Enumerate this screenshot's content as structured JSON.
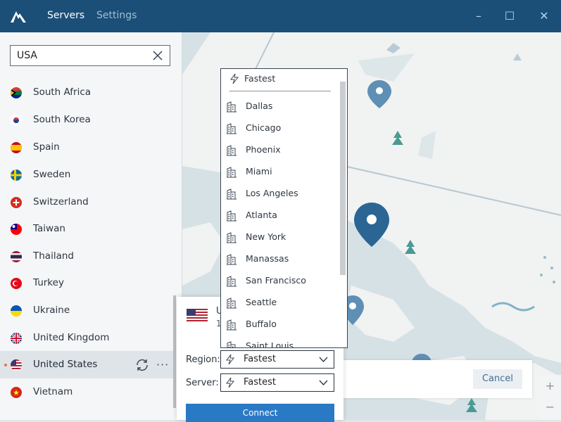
{
  "header": {
    "tabs": [
      "Servers",
      "Settings"
    ],
    "window_controls": [
      "minimize-icon",
      "maximize-icon",
      "close-icon"
    ]
  },
  "search": {
    "value": "USA"
  },
  "countries": [
    {
      "name": "South Africa",
      "flag": "south-africa-flag-icon"
    },
    {
      "name": "South Korea",
      "flag": "south-korea-flag-icon"
    },
    {
      "name": "Spain",
      "flag": "spain-flag-icon"
    },
    {
      "name": "Sweden",
      "flag": "sweden-flag-icon"
    },
    {
      "name": "Switzerland",
      "flag": "switzerland-flag-icon"
    },
    {
      "name": "Taiwan",
      "flag": "taiwan-flag-icon"
    },
    {
      "name": "Thailand",
      "flag": "thailand-flag-icon"
    },
    {
      "name": "Turkey",
      "flag": "turkey-flag-icon"
    },
    {
      "name": "Ukraine",
      "flag": "ukraine-flag-icon"
    },
    {
      "name": "United Kingdom",
      "flag": "uk-flag-icon"
    },
    {
      "name": "United States",
      "flag": "us-flag-icon",
      "selected": true
    },
    {
      "name": "Vietnam",
      "flag": "vietnam-flag-icon"
    }
  ],
  "panel": {
    "title": "U",
    "subtitle": "1",
    "region_label": "Region:",
    "region_value": "Fastest",
    "server_label": "Server:",
    "server_value": "Fastest",
    "connect_label": "Connect"
  },
  "dropdown": {
    "fastest": "Fastest",
    "cities": [
      "Dallas",
      "Chicago",
      "Phoenix",
      "Miami",
      "Los Angeles",
      "Atlanta",
      "New York",
      "Manassas",
      "San Francisco",
      "Seattle",
      "Buffalo",
      "Saint Louis"
    ]
  },
  "cancel_label": "Cancel",
  "zoom": {
    "in": "+",
    "out": "−"
  },
  "colors": {
    "titlebar": "#1b4f78",
    "accent": "#2a79c5",
    "pin": "#2a6594"
  }
}
